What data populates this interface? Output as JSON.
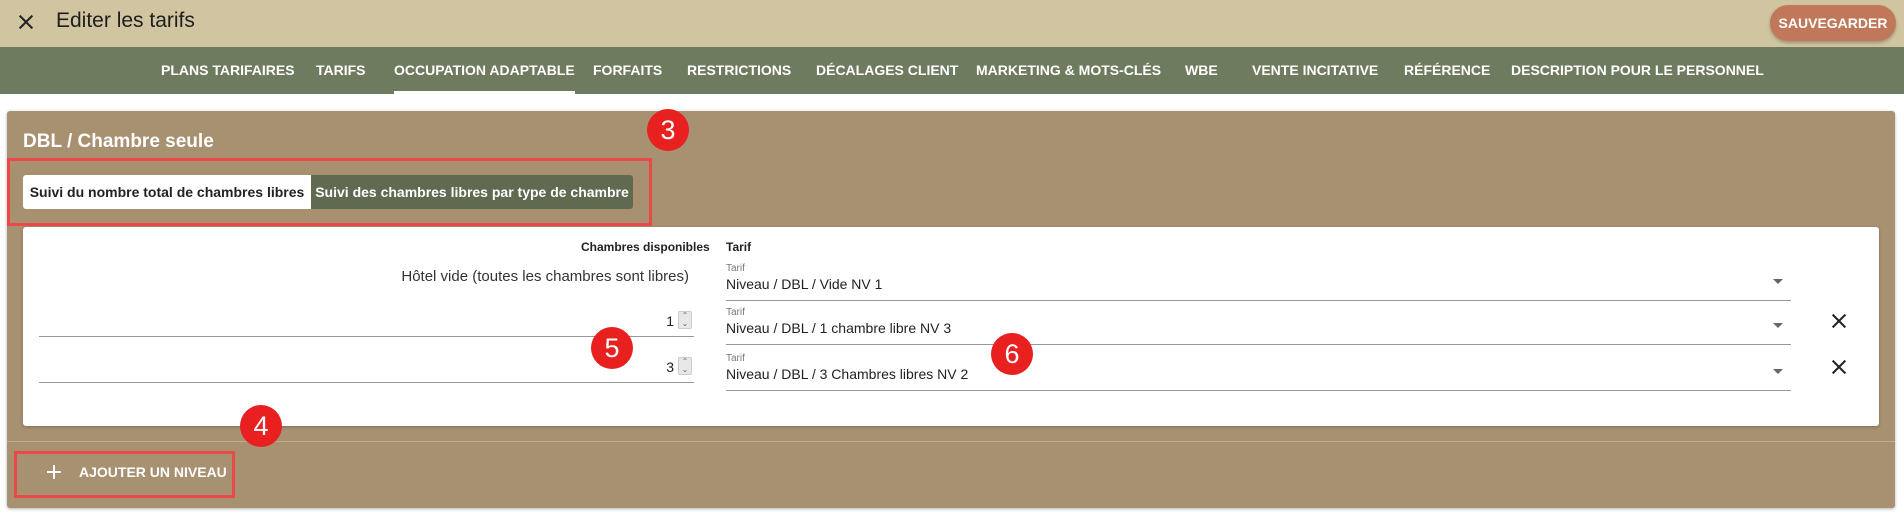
{
  "header": {
    "title": "Editer les tarifs",
    "save_label": "SAUVEGARDER",
    "close_icon": "close-icon"
  },
  "tabs": [
    {
      "label": "PLANS TARIFAIRES",
      "active": false
    },
    {
      "label": "TARIFS",
      "active": false
    },
    {
      "label": "OCCUPATION ADAPTABLE",
      "active": true
    },
    {
      "label": "FORFAITS",
      "active": false
    },
    {
      "label": "RESTRICTIONS",
      "active": false
    },
    {
      "label": "DÉCALAGES CLIENT",
      "active": false
    },
    {
      "label": "MARKETING & MOTS-CLÉS",
      "active": false
    },
    {
      "label": "WBE",
      "active": false
    },
    {
      "label": "VENTE INCITATIVE",
      "active": false
    },
    {
      "label": "RÉFÉRENCE",
      "active": false
    },
    {
      "label": "DESCRIPTION POUR LE PERSONNEL",
      "active": false
    }
  ],
  "panel": {
    "title": "DBL / Chambre seule",
    "toggle": {
      "option_total": "Suivi du nombre total de chambres libres",
      "option_by_type": "Suivi des chambres libres par type de chambre",
      "selected": "option_total"
    },
    "table": {
      "col_rooms": "Chambres disponibles",
      "col_tarif": "Tarif",
      "rows": [
        {
          "rooms_label": "Hôtel vide (toutes les chambres sont libres)",
          "tarif_label": "Tarif",
          "tarif_value": "Niveau / DBL / Vide NV 1"
        },
        {
          "rooms_value": "1",
          "tarif_label": "Tarif",
          "tarif_value": "Niveau / DBL / 1 chambre libre NV 3"
        },
        {
          "rooms_value": "3",
          "tarif_label": "Tarif",
          "tarif_value": "Niveau / DBL / 3 Chambres libres NV 2"
        }
      ]
    },
    "add_level_label": "AJOUTER UN NIVEAU"
  },
  "annotations": [
    "3",
    "4",
    "5",
    "6"
  ],
  "colors": {
    "header_bg": "#d1c4a0",
    "tabbar_bg": "#6f7b5e",
    "panel_bg": "#a89171",
    "save_button": "#c0775a",
    "annotation_red": "#e8201f"
  }
}
